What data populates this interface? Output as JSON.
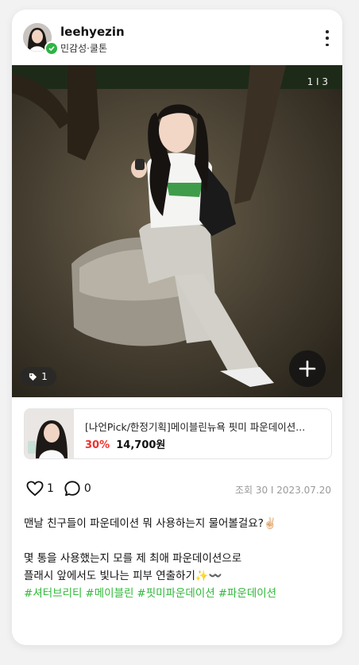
{
  "header": {
    "username": "leehyezin",
    "subtitle": "민감성·쿨톤"
  },
  "photo": {
    "counter": "1 I 3",
    "tag_count": "1"
  },
  "product": {
    "name": "[나언Pick/한정기획]메이블린뉴욕 핏미 파운데이션...",
    "discount": "30%",
    "price": "14,700원"
  },
  "actions": {
    "like_count": "1",
    "comment_count": "0"
  },
  "meta": {
    "views_date": "조회 30 I 2023.07.20"
  },
  "caption": {
    "line1": "맨날 친구들이 파운데이션 뭐 사용하는지 물어볼걸요?✌🏻",
    "line2": "몇 통을 사용했는지 모를 제 최애 파운데이션으로",
    "line3": "플래시 앞에서도 빛나는 피부 연출하기✨〰️",
    "hashtags": [
      "#셔터브리티",
      "#메이블린",
      "#핏미파운데이션",
      "#파운데이션"
    ]
  },
  "colors": {
    "discount": "#f0302e",
    "hashtag": "#30b83a",
    "verified": "#2fb344",
    "meta": "#9a9a9a"
  },
  "icons": [
    "verified-icon",
    "more-icon",
    "tag-icon",
    "plus-icon",
    "heart-icon",
    "comment-icon"
  ]
}
